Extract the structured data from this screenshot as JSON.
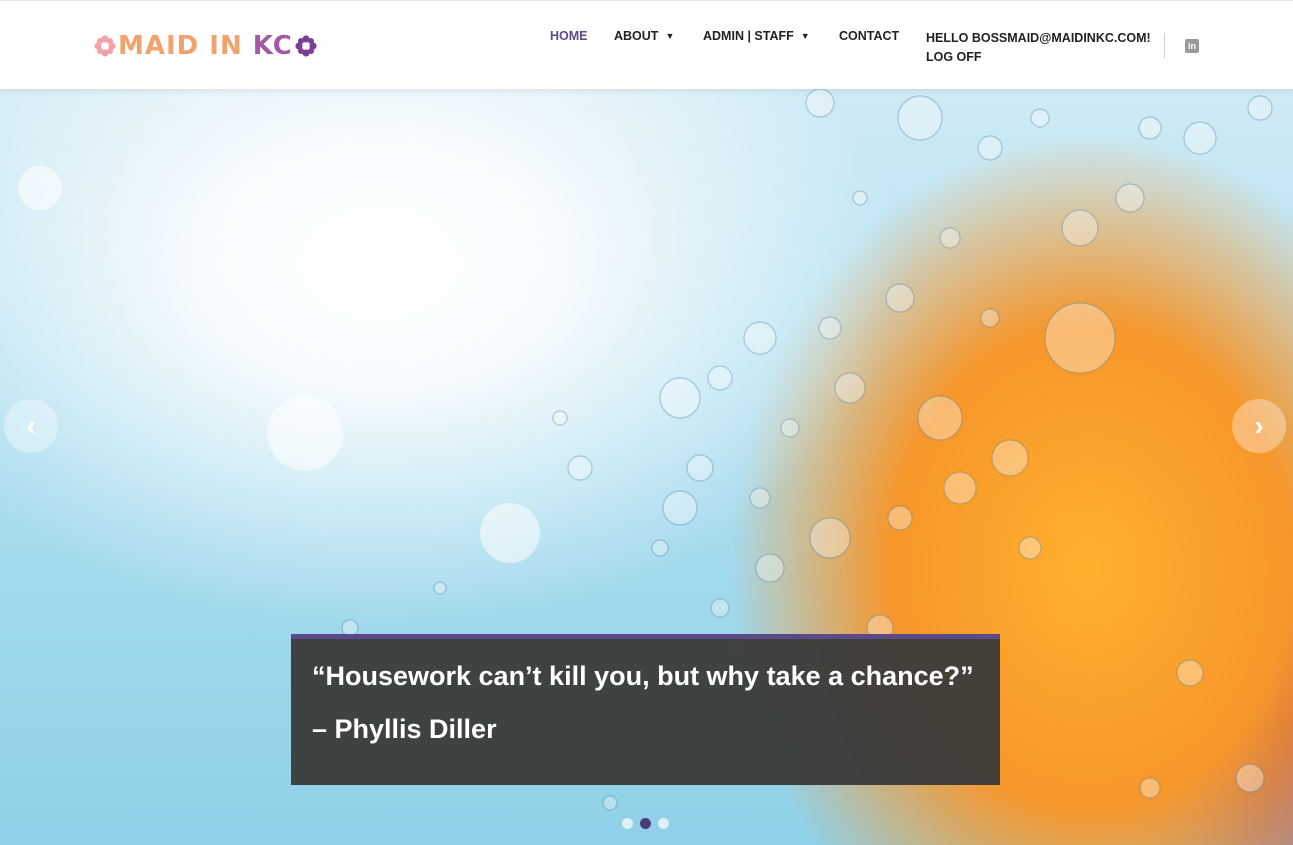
{
  "logo": {
    "part1": "MAID IN",
    "part2": "KC"
  },
  "nav": {
    "home": "HOME",
    "about": "ABOUT",
    "admin": "ADMIN | STAFF",
    "contact": "CONTACT",
    "user_greeting": "HELLO BOSSMAID@MAIDINKC.COM!",
    "log_off": "LOG OFF"
  },
  "social": {
    "linkedin_label": "in"
  },
  "slider": {
    "prev_arrow": "‹",
    "next_arrow": "›",
    "quote": "“Housework can’t kill you, but why take a chance?”",
    "author": "– Phyllis Diller",
    "dots": [
      {
        "active": false
      },
      {
        "active": true
      },
      {
        "active": false
      }
    ]
  },
  "colors": {
    "accent": "#5b4a8a",
    "logo_orange": "#f2a26c",
    "logo_purple": "#a35aa6",
    "caption_bg": "#3a3a3a"
  },
  "icons": {
    "logo_left": "flower-icon",
    "logo_right": "flower-icon",
    "dropdown": "chevron-down-icon",
    "social": "linkedin-icon",
    "prev": "chevron-left-icon",
    "next": "chevron-right-icon"
  }
}
